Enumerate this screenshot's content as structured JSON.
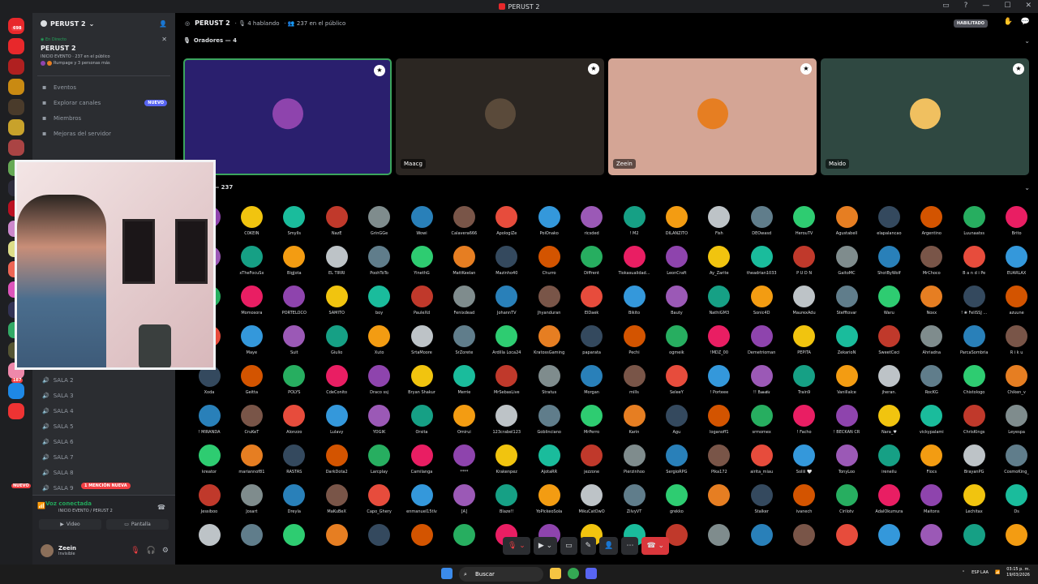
{
  "titlebar": {
    "title": "PERUST 2",
    "controls": [
      "inbox-icon",
      "help-icon",
      "minimize-icon",
      "maximize-icon",
      "close-icon"
    ]
  },
  "servers": {
    "badges": [
      "698",
      "187",
      "NUEVO"
    ],
    "colors": [
      "#e8282b",
      "#e8282b",
      "#b02020",
      "#c98a12",
      "#4a3b2b",
      "#c8a22b",
      "#a44",
      "#6a5",
      "#2e2e3e",
      "#b12",
      "#c8c",
      "#dd8",
      "#e65",
      "#d5b",
      "#335",
      "#3a6",
      "#553",
      "#e8a",
      "#1e88e5",
      "#e33"
    ]
  },
  "channels": {
    "guild_name": "PERUST 2",
    "live": {
      "tag": "En Directo",
      "title": "PERUST 2",
      "sub": "INICIO EVENTO · 237 en el público",
      "people": "Rumpage y 3 personas más"
    },
    "nav": [
      {
        "label": "Eventos",
        "icon": "calendar-icon"
      },
      {
        "label": "Explorar canales",
        "icon": "channels-icon",
        "badge": "NUEVO"
      },
      {
        "label": "Miembros",
        "icon": "members-icon"
      },
      {
        "label": "Mejoras del servidor",
        "icon": "boost-icon"
      }
    ],
    "salas": [
      "SALA 2",
      "SALA 3",
      "SALA 4",
      "SALA 5",
      "SALA 6",
      "SALA 7",
      "SALA 8",
      "SALA 9"
    ],
    "mention_badge": "1 MENCIÓN NUEVA"
  },
  "voice": {
    "status": "Voz conectada",
    "location": "INICIO EVENTO / PERUST 2",
    "video_label": "Video",
    "screen_label": "Pantalla"
  },
  "user": {
    "name": "Zeein",
    "status": "Invisible"
  },
  "stage": {
    "title": "PERUST 2",
    "speaking": "4 hablando",
    "public": "237 en el público",
    "habilitado": "HABILITADO",
    "speakers_header": "Oradores — 4",
    "audience_header": "o — 237",
    "speakers": [
      {
        "name": "",
        "bg": "#2a1f6e",
        "avatar": "#8e44ad",
        "border": "#3ba55d"
      },
      {
        "name": "Maacg",
        "bg": "#2b2622",
        "avatar": "#5a4a3a",
        "border": ""
      },
      {
        "name": "Zeein",
        "bg": "#d4a595",
        "avatar": "#e67e22",
        "border": ""
      },
      {
        "name": "Maido",
        "bg": "#2f4841",
        "avatar": "#f0c060",
        "border": ""
      }
    ]
  },
  "audience": [
    [
      "",
      "C0KEIN",
      "Smylls",
      "NazE",
      "GrinGGe",
      "Wowi",
      "Calavera666",
      "ApologiZe",
      "PoiOnako",
      "ricsded",
      "! M2",
      "DILANZITO",
      "Fish",
      "DEOwasd",
      "HerouTV",
      "Agustabell",
      "elapalancao",
      "Argentino",
      "Luunaatss",
      "Brito"
    ],
    [
      "",
      "xTheFocuSx",
      "BigJota",
      "EL TIRRI",
      "PoohToTo",
      "YinethG",
      "MattKeelan",
      "Mazinho40",
      "Churro",
      "Diffrent",
      "Tiokasualidad...",
      "LeonCraft",
      "Ay_Zarite",
      "theadrian1033",
      "P U D N",
      "GaitoMC",
      "ShotByWolf",
      "MrChoco",
      "B a n d i Pe",
      "EUARLAX"
    ],
    [
      "Y",
      "Momosora",
      "PORTELOCO",
      "SAMITO",
      "boy",
      "PauleXd",
      "Fenixdead",
      "JohannTV",
      "Jhyanduran",
      "ElDaek",
      "Bikito",
      "Bauty",
      "NathiGM3",
      "Sonic4D",
      "MaurexAdu",
      "Stefftovar",
      "Waru",
      "Noxx",
      "! ❀ FeliSSJ ...",
      "azuune"
    ],
    [
      "",
      "Maye",
      "Suit",
      "Giulio",
      "Xuto",
      "SrtaMoore",
      "SrZorete",
      "Ardilla Loca24",
      "KratossGaming",
      "paparata",
      "Pechi",
      "ogmeik",
      "!MDZ_00",
      "Demetrioman",
      "PEPITA",
      "ZekarioN",
      "SweetCeci",
      "Ahriadna",
      "ParcaSombria",
      "R i k u"
    ],
    [
      "Xoda",
      "Geitta",
      "POLYS",
      "CdeConito",
      "Draco ssj",
      "Bryan Shakur",
      "Merrie",
      "MrSebasLive",
      "Stratus",
      "Morgan",
      "mills",
      "SeleeY",
      "! Porteee",
      "!! 𝕷𝖚𝖓𝖆𝖙𝖎𝖈",
      "Train9",
      "Vanillalce",
      "jheran.",
      "RocKG",
      "Chistologo",
      "Chiken_v"
    ],
    [
      "! MIRANDA",
      "CruKeT",
      "Alonzzo",
      "Lulavy",
      "YOGIK",
      "Orsita",
      "Omirui",
      "123crabel123",
      "Goblinciano",
      "MrPerro",
      "Karin",
      "Agu",
      "loganoff1",
      "srmomex",
      "! Facho",
      "! BECKAN CR",
      "Nara_♥",
      "vickypalami",
      "ChrisKings",
      "Leyespa"
    ],
    [
      "kreator",
      "mariannof81",
      "RASTAS",
      "DarkDota2",
      "Larcplay",
      "Camilanga",
      "****",
      "Krakenpez",
      "AjotaRR",
      "jezzone",
      "Pierzinhoo",
      "SergioRPG",
      "Pika172",
      "airita_miau",
      "Soliii 🤍",
      "TonyLoo",
      "ireneilu",
      "Flocs",
      "BrayanPG",
      "CosmoKing_"
    ],
    [
      "Jessiboo",
      "Josart",
      "Dreyla",
      "MaKuBeX",
      "Capo_Ghery",
      "enmanuel15tlv",
      "[A]",
      "Blaze!!",
      "YoPickeoSola",
      "MikuCatOwO",
      "ZilvyVT",
      "grekko",
      "",
      "Stalker",
      "ivanech",
      "Cirilotv",
      "AdalOkumura",
      "Maitons",
      "Lechitax",
      "Ds"
    ],
    [
      "",
      "",
      "",
      "",
      "",
      "",
      "",
      "",
      "",
      "",
      "",
      "",
      "",
      "",
      "",
      "",
      "",
      "",
      "",
      ""
    ]
  ],
  "audience_colors": [
    "#8e44ad",
    "#e74c3c",
    "#2ecc71",
    "#f1c40f",
    "#3498db",
    "#e67e22",
    "#1abc9c",
    "#9b59b6",
    "#34495e",
    "#c0392b",
    "#16a085",
    "#d35400",
    "#7f8c8d",
    "#f39c12",
    "#27ae60",
    "#2980b9",
    "#bdc3c7",
    "#e91e63",
    "#795548",
    "#607d8b"
  ],
  "taskbar": {
    "search": "Buscar",
    "lang": "ESP LAA",
    "time": "03:15 p. m.",
    "date": "19/03/2026"
  }
}
